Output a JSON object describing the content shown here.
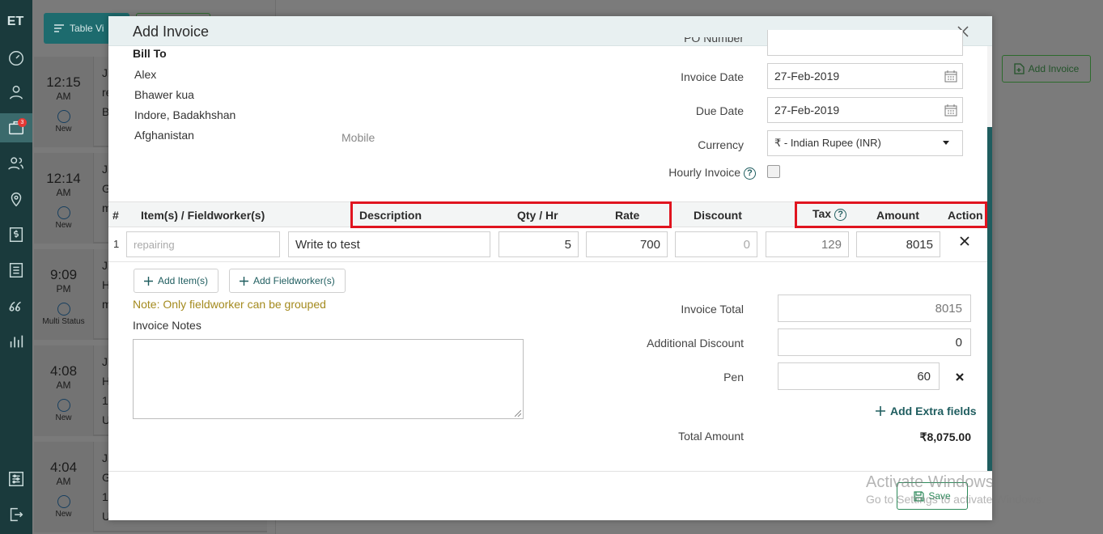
{
  "app": {
    "logo": "ET",
    "badge_count": "3",
    "table_view_label": "Table Vi",
    "add_invoice_label": "Add Invoice"
  },
  "jobs": [
    {
      "time": "12:15",
      "ampm": "AM",
      "status": "New",
      "lines": [
        "Ji",
        "re",
        "B"
      ]
    },
    {
      "time": "12:14",
      "ampm": "AM",
      "status": "New",
      "lines": [
        "Ji",
        "G",
        "m"
      ]
    },
    {
      "time": "9:09",
      "ampm": "PM",
      "status": "Multi Status",
      "lines": [
        "Ji",
        "H",
        "m"
      ]
    },
    {
      "time": "4:08",
      "ampm": "AM",
      "status": "New",
      "lines": [
        "Ji",
        "H",
        "1",
        "U"
      ]
    },
    {
      "time": "4:04",
      "ampm": "AM",
      "status": "New",
      "lines": [
        "Ji",
        "G",
        "1",
        "U"
      ]
    }
  ],
  "modal": {
    "title": "Add Invoice",
    "bill_to": {
      "label": "Bill To",
      "name": "Alex",
      "street": "Bhawer kua",
      "city": "Indore, Badakhshan",
      "country": "Afghanistan",
      "mobile_placeholder": "Mobile"
    },
    "fields": {
      "po_number_label": "PO Number",
      "invoice_date_label": "Invoice Date",
      "invoice_date_value": "27-Feb-2019",
      "due_date_label": "Due Date",
      "due_date_value": "27-Feb-2019",
      "currency_label": "Currency",
      "currency_value": "₹ - Indian Rupee (INR)",
      "hourly_invoice_label": "Hourly Invoice"
    },
    "table": {
      "headers": {
        "num": "#",
        "item": "Item(s) / Fieldworker(s)",
        "description": "Description",
        "qty": "Qty / Hr",
        "rate": "Rate",
        "discount": "Discount",
        "tax": "Tax",
        "amount": "Amount",
        "action": "Action"
      },
      "rows": [
        {
          "num": "1",
          "item_placeholder": "repairing",
          "description": "Write to test",
          "qty": "5",
          "rate": "700",
          "discount": "0",
          "tax": "129",
          "amount": "8015"
        }
      ]
    },
    "add_item_label": "Add Item(s)",
    "add_fieldworker_label": "Add Fieldworker(s)",
    "note": "Note: Only fieldworker can be grouped",
    "invoice_notes_label": "Invoice Notes",
    "totals": {
      "invoice_total_label": "Invoice Total",
      "invoice_total_value": "8015",
      "additional_discount_label": "Additional Discount",
      "additional_discount_value": "0",
      "pen_label": "Pen",
      "pen_value": "60",
      "add_extra_fields_label": "Add Extra fields",
      "total_amount_label": "Total Amount",
      "total_amount_value": "₹8,075.00"
    },
    "save_label": "Save"
  },
  "watermark": {
    "line1": "Activate Windows",
    "line2": "Go to Settings to activate Windows."
  },
  "colors": {
    "sidebar": "#1a3a3c",
    "accent": "#1f5d5f",
    "highlight_box": "#e0141f",
    "note_text": "#a48a1e",
    "save_green": "#2c8a5a"
  }
}
